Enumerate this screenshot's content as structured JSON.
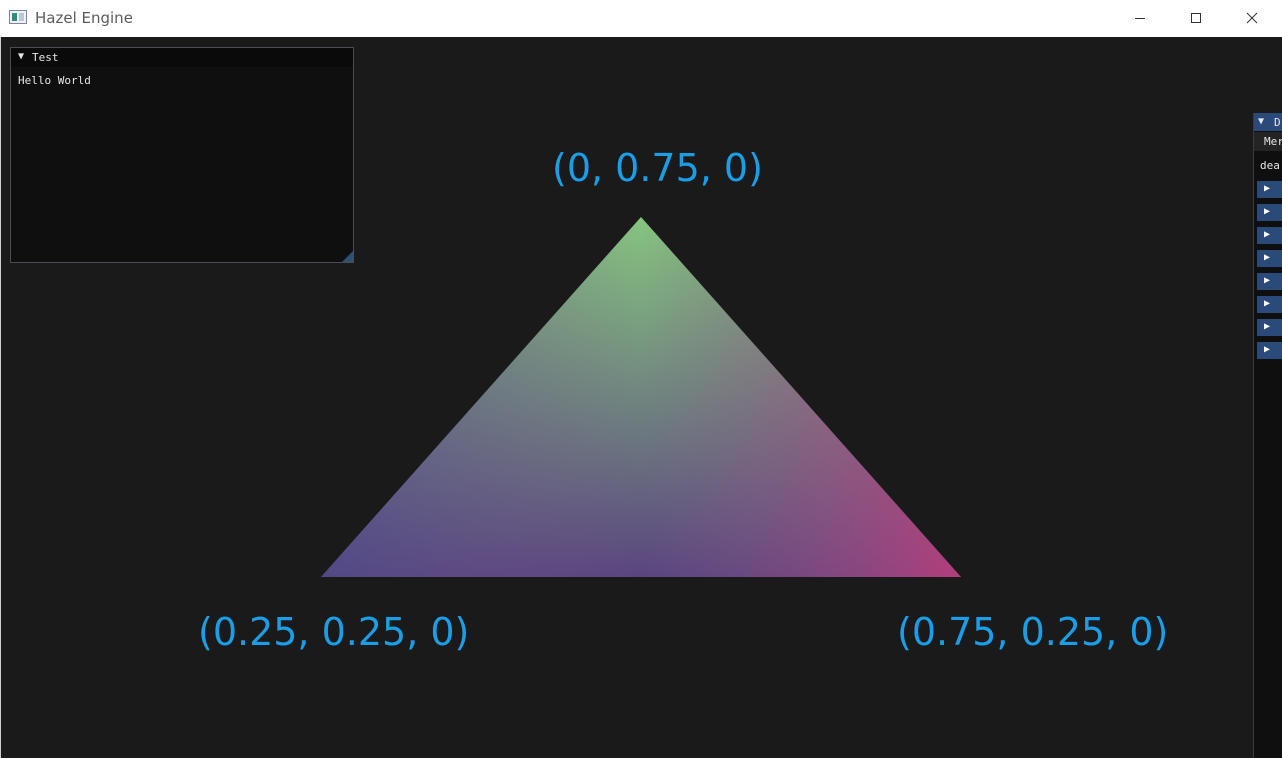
{
  "window": {
    "title": "Hazel Engine",
    "controls": {
      "minimize": "minimize-icon",
      "maximize": "maximize-icon",
      "close": "close-icon"
    }
  },
  "test_window": {
    "title": "Test",
    "collapse_arrow": "▼",
    "body_text": "Hello World"
  },
  "vertex_labels": {
    "top": "(0, 0.75, 0)",
    "bottom_left": "(0.25, 0.25, 0)",
    "bottom_right": "(0.75, 0.25, 0)"
  },
  "side_panel": {
    "title_arrow": "▼",
    "title_fragment": "D",
    "menu_fragment": "Mer",
    "text_fragment": "dea",
    "expand_arrows": [
      "▶",
      "▶",
      "▶",
      "▶",
      "▶",
      "▶",
      "▶",
      "▶"
    ]
  },
  "colors": {
    "background": "#1a1a1a",
    "label_blue": "#1a9ee8",
    "vertex_top": "#86c57f",
    "vertex_bottom_left": "#4a4b8c",
    "vertex_bottom_right": "#c23c7a",
    "accent_panel": "#294a7a"
  }
}
